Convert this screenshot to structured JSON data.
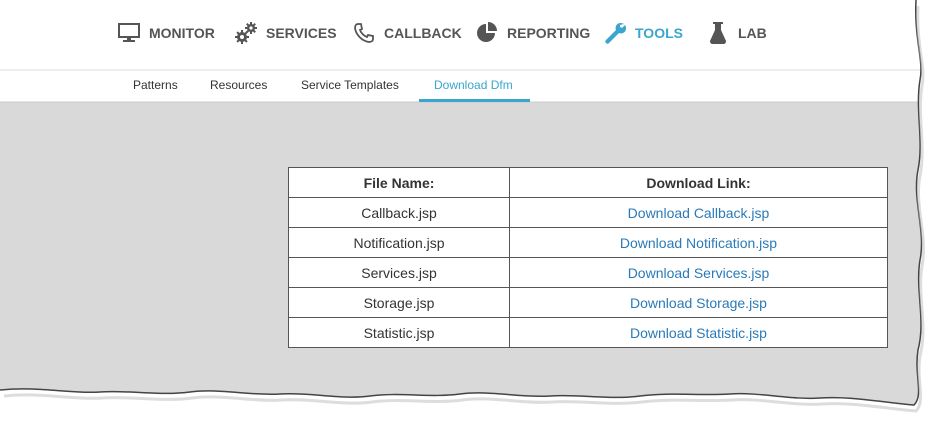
{
  "nav": {
    "items": [
      {
        "label": "MONITOR",
        "icon": "monitor-icon"
      },
      {
        "label": "SERVICES",
        "icon": "gears-icon"
      },
      {
        "label": "CALLBACK",
        "icon": "phone-icon"
      },
      {
        "label": "REPORTING",
        "icon": "pie-chart-icon"
      },
      {
        "label": "TOOLS",
        "icon": "wrench-icon",
        "active": true
      },
      {
        "label": "LAB",
        "icon": "flask-icon"
      }
    ]
  },
  "subnav": {
    "items": [
      {
        "label": "Patterns"
      },
      {
        "label": "Resources"
      },
      {
        "label": "Service Templates"
      },
      {
        "label": "Download Dfm",
        "active": true
      }
    ]
  },
  "table": {
    "headers": {
      "name": "File Name:",
      "link": "Download Link:"
    },
    "rows": [
      {
        "name": "Callback.jsp",
        "link": "Download Callback.jsp"
      },
      {
        "name": "Notification.jsp",
        "link": "Download Notification.jsp"
      },
      {
        "name": "Services.jsp",
        "link": "Download Services.jsp"
      },
      {
        "name": "Storage.jsp",
        "link": "Download Storage.jsp"
      },
      {
        "name": "Statistic.jsp",
        "link": "Download Statistic.jsp"
      }
    ]
  },
  "colors": {
    "accent": "#3aa6cf",
    "link": "#2a7ab8",
    "nav_text": "#555555",
    "content_bg": "#d9d9d9"
  }
}
